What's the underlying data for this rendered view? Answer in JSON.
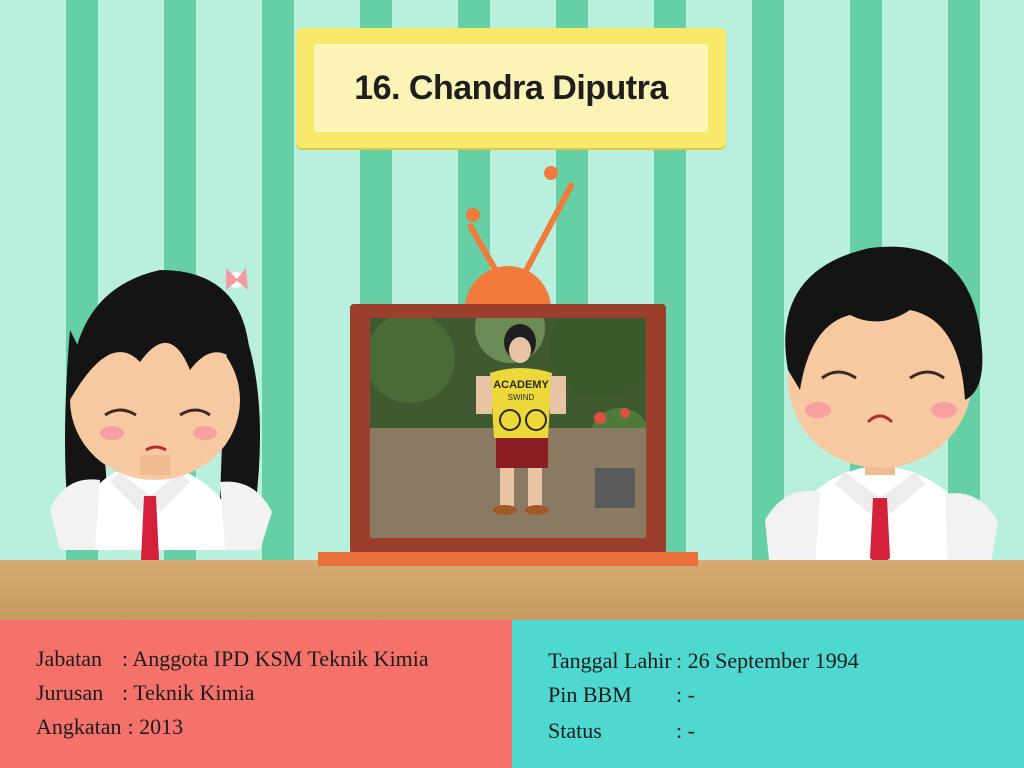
{
  "title": "16. Chandra Diputra",
  "photo": {
    "shirt_text_1": "ACADEMY",
    "shirt_text_2": "SWIND"
  },
  "info_left": [
    {
      "label": "Jabatan",
      "value": ": Anggota IPD KSM Teknik Kimia"
    },
    {
      "label": "Jurusan",
      "value": ": Teknik Kimia"
    },
    {
      "label": "Angkatan",
      "value": ": 2013"
    }
  ],
  "info_right": [
    {
      "label": "Tanggal Lahir",
      "value": ": 26 September 1994"
    },
    {
      "label": "Pin BBM",
      "value": ": -"
    },
    {
      "label": "Status",
      "value": ": -"
    }
  ],
  "colors": {
    "wall_light": "#b9f0dd",
    "wall_stripe": "#66cfa6",
    "sign": "#f8e96a",
    "tv_frame": "#9c3e2c",
    "tv_orange": "#f07b3a",
    "panel_left": "#f5726b",
    "panel_right": "#4fd8d0",
    "table": "#d6ab73",
    "tie": "#d4203a"
  }
}
